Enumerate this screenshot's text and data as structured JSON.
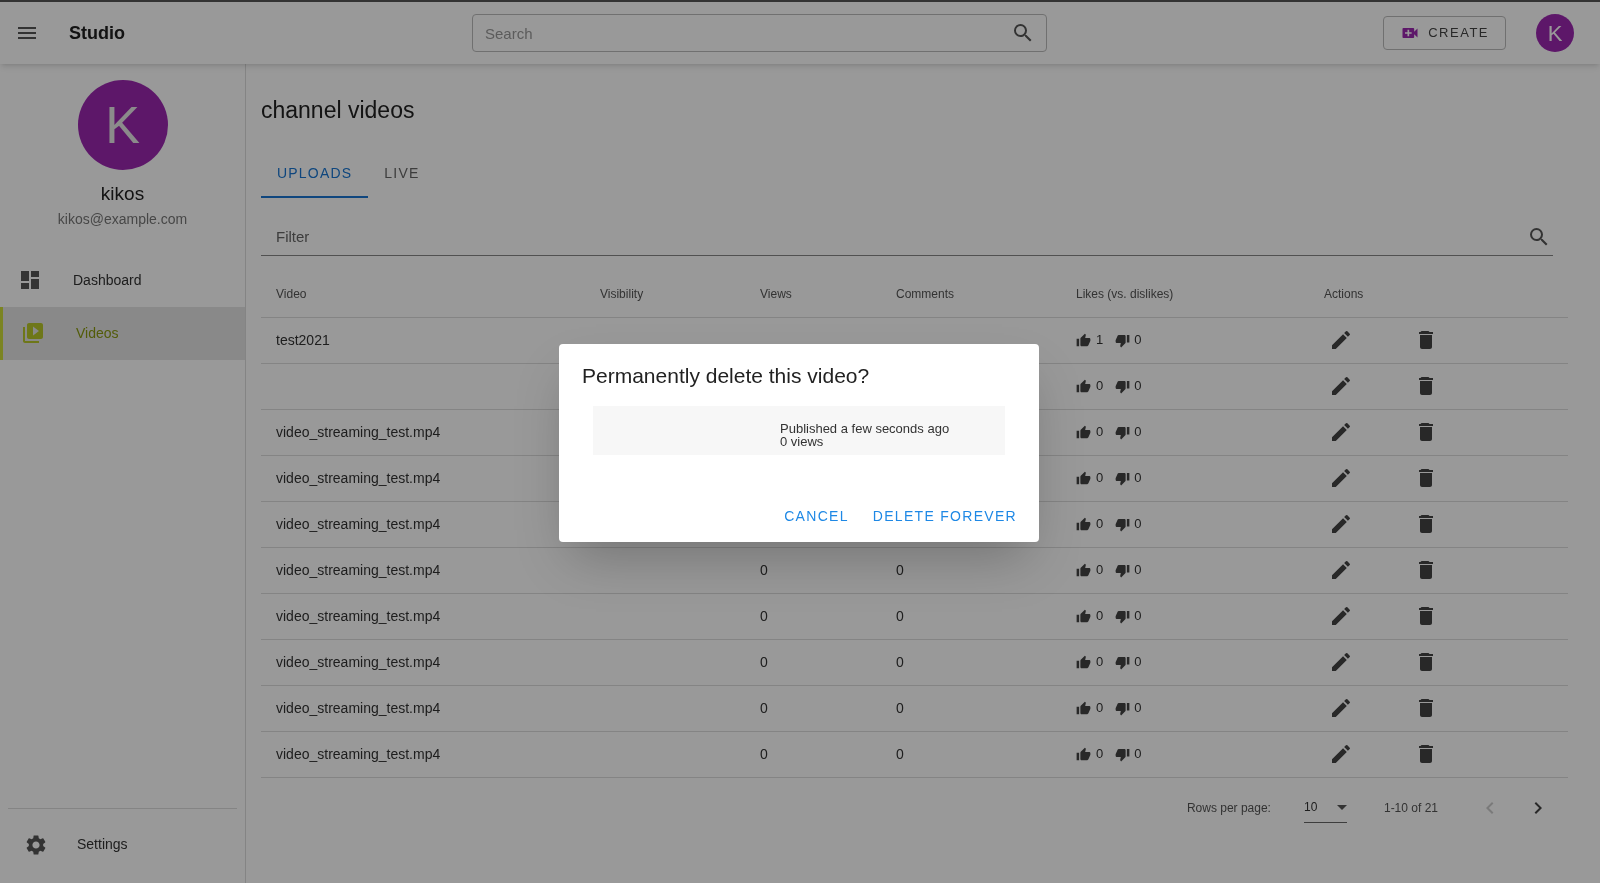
{
  "app": {
    "title": "Studio"
  },
  "search": {
    "placeholder": "Search"
  },
  "create_button": {
    "label": "CREATE"
  },
  "account_avatar": {
    "letter": "K"
  },
  "profile": {
    "avatar": "K",
    "name": "kikos",
    "email": "kikos@example.com"
  },
  "nav": [
    {
      "label": "Dashboard",
      "selected": false
    },
    {
      "label": "Videos",
      "selected": true
    }
  ],
  "settings": {
    "label": "Settings"
  },
  "page_title": "channel videos",
  "tabs": [
    {
      "label": "UPLOADS",
      "selected": true
    },
    {
      "label": "LIVE",
      "selected": false
    }
  ],
  "filter": {
    "placeholder": "Filter"
  },
  "table": {
    "columns": [
      "Video",
      "Visibility",
      "Views",
      "Comments",
      "Likes (vs. dislikes)",
      "Actions"
    ],
    "rows": [
      {
        "video": "test2021",
        "likes": "1",
        "dislikes": "0"
      },
      {
        "likes": "0",
        "dislikes": "0"
      },
      {
        "video": "video_streaming_test.mp4",
        "likes": "0",
        "dislikes": "0"
      },
      {
        "video": "video_streaming_test.mp4",
        "likes": "0",
        "dislikes": "0"
      },
      {
        "video": "video_streaming_test.mp4",
        "likes": "0",
        "dislikes": "0"
      },
      {
        "video": "video_streaming_test.mp4",
        "views": "0",
        "comments": "0",
        "likes": "0",
        "dislikes": "0"
      },
      {
        "video": "video_streaming_test.mp4",
        "views": "0",
        "comments": "0",
        "likes": "0",
        "dislikes": "0"
      },
      {
        "video": "video_streaming_test.mp4",
        "views": "0",
        "comments": "0",
        "likes": "0",
        "dislikes": "0"
      },
      {
        "video": "video_streaming_test.mp4",
        "views": "0",
        "comments": "0",
        "likes": "0",
        "dislikes": "0"
      },
      {
        "video": "video_streaming_test.mp4",
        "views": "0",
        "comments": "0",
        "likes": "0",
        "dislikes": "0"
      }
    ]
  },
  "pagination": {
    "rows_per_page_label": "Rows per page:",
    "rows_per_page": "10",
    "range": "1-10 of 21",
    "previous_disabled": true,
    "next_disabled": false
  },
  "dialog": {
    "title": "Permanently delete this video?",
    "published": "Published a few seconds ago",
    "views": "0 views",
    "buttons": [
      "CANCEL",
      "DELETE FOREVER"
    ]
  }
}
